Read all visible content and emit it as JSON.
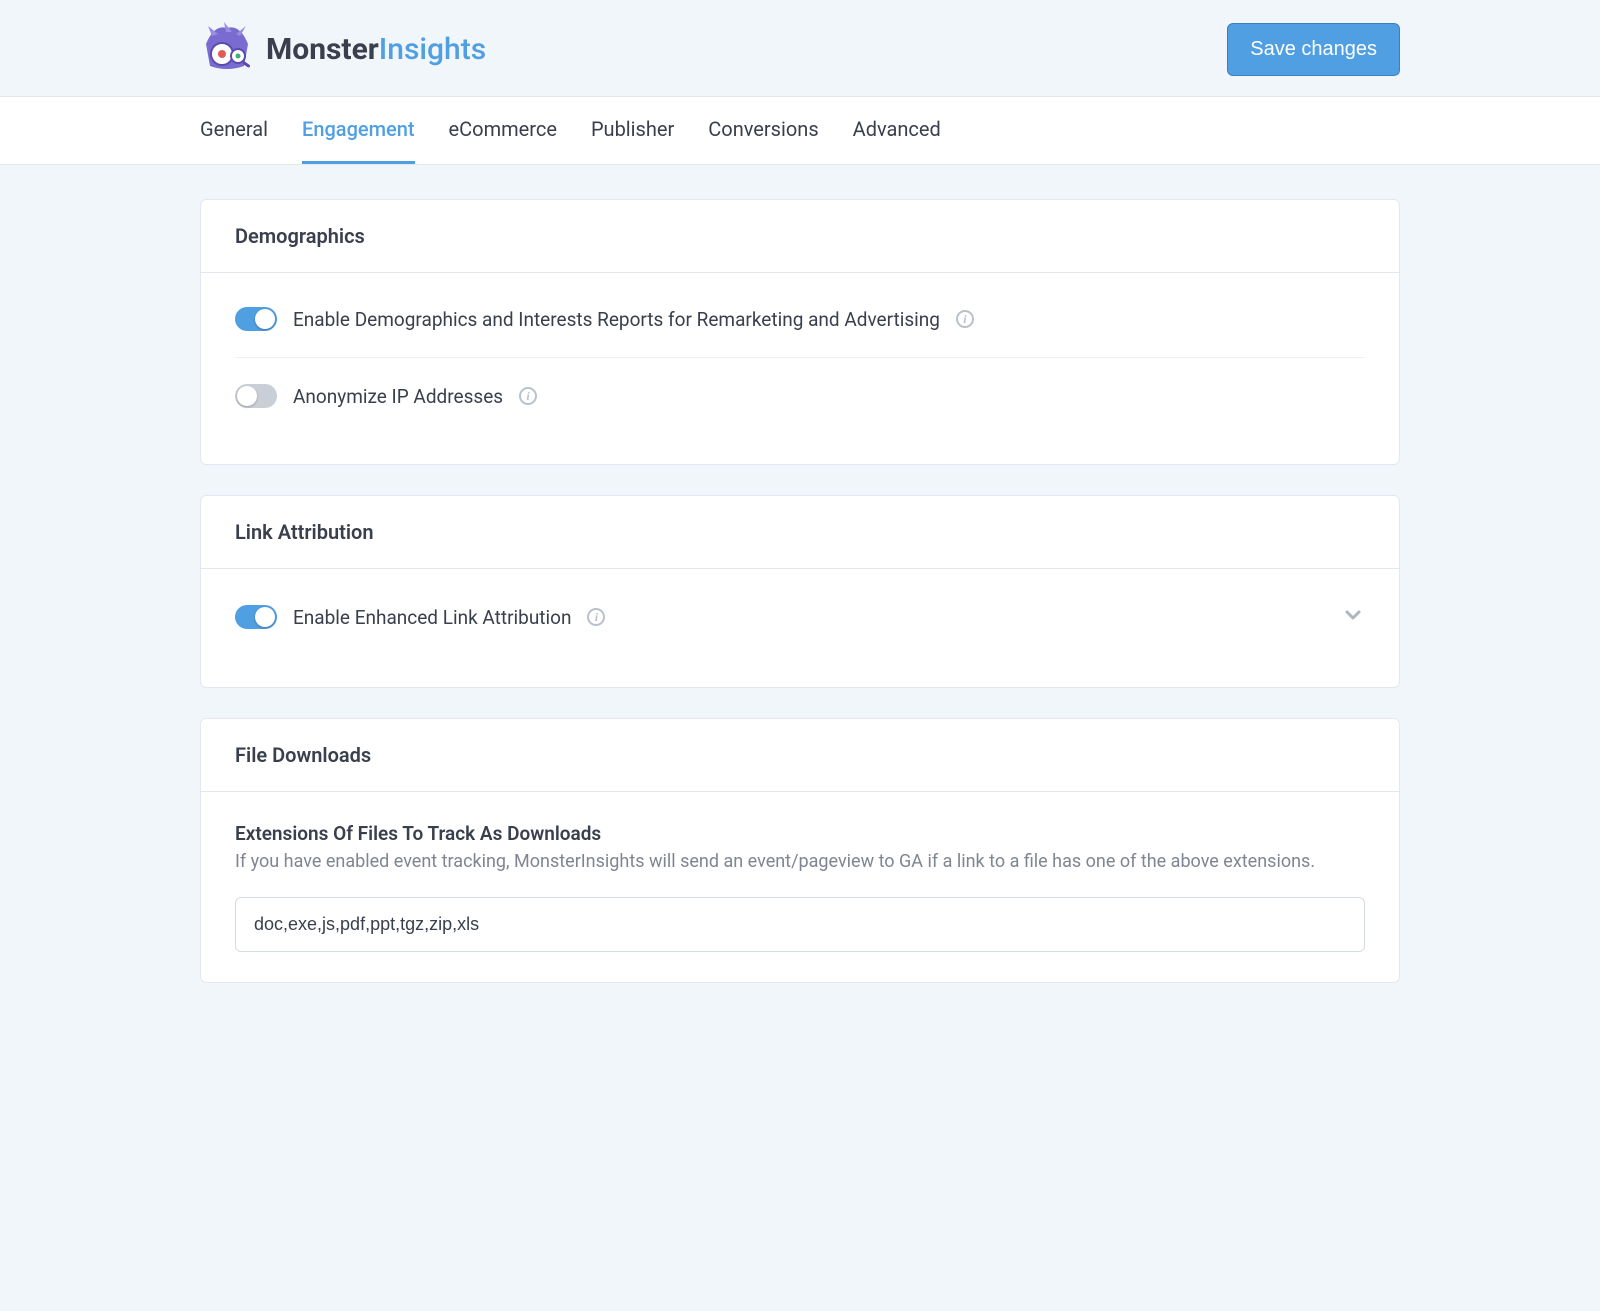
{
  "header": {
    "brand_a": "Monster",
    "brand_b": "Insights",
    "save_label": "Save changes"
  },
  "tabs": {
    "general": "General",
    "engagement": "Engagement",
    "ecommerce": "eCommerce",
    "publisher": "Publisher",
    "conversions": "Conversions",
    "advanced": "Advanced"
  },
  "panels": {
    "demographics": {
      "title": "Demographics",
      "enable_label": "Enable Demographics and Interests Reports for Remarketing and Advertising",
      "anonymize_label": "Anonymize IP Addresses"
    },
    "link_attr": {
      "title": "Link Attribution",
      "enable_label": "Enable Enhanced Link Attribution"
    },
    "file_downloads": {
      "title": "File Downloads",
      "field_title": "Extensions Of Files To Track As Downloads",
      "field_desc": "If you have enabled event tracking, MonsterInsights will send an event/pageview to GA if a link to a file has one of the above extensions.",
      "value": "doc,exe,js,pdf,ppt,tgz,zip,xls"
    }
  },
  "colors": {
    "accent": "#509fe2"
  }
}
